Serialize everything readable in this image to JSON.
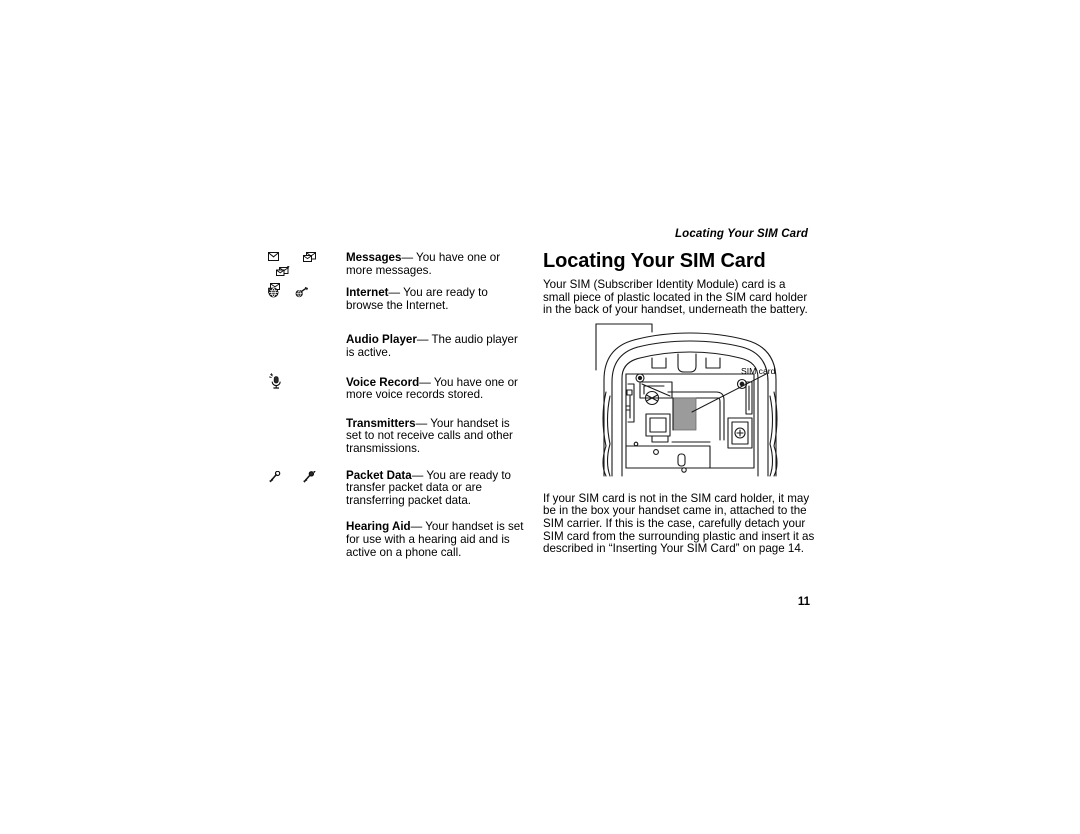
{
  "page": {
    "running_header": "Locating Your SIM Card",
    "folio": "11"
  },
  "left_column": {
    "entries": [
      {
        "term": "Messages",
        "dash": "—",
        "description": " You have one or more messages.",
        "icons": [
          "envelope-icon",
          "message-stack-icon",
          "message-stack-alert-icon",
          "message-open-icon"
        ]
      },
      {
        "term": "Internet",
        "dash": "—",
        "description": " You are ready to browse the Internet.",
        "icons": [
          "globe-icon",
          "globe-key-icon"
        ]
      },
      {
        "term": "Audio Player",
        "dash": "—",
        "description": " The audio player is active.",
        "icons": []
      },
      {
        "term": "Voice Record",
        "dash": "—",
        "description": " You have one or more voice records stored.",
        "icons": [
          "microphone-icon"
        ]
      },
      {
        "term": "Transmitters",
        "dash": "—",
        "description": " Your handset is set to not receive calls and other transmissions.",
        "icons": []
      },
      {
        "term": "Packet Data",
        "dash": "—",
        "description": " You are ready to transfer packet data or are transferring packet data.",
        "icons": [
          "packet-data-icon",
          "packet-data-active-icon"
        ]
      },
      {
        "term": "Hearing Aid",
        "dash": "—",
        "description": " Your handset is set for use with a hearing aid and is active on a phone call.",
        "icons": []
      }
    ]
  },
  "right_column": {
    "title": "Locating Your SIM Card",
    "intro_paragraph": "Your SIM (Subscriber Identity Module) card is a small piece of plastic located in the SIM card holder in the back of your handset, underneath the battery.",
    "figure": {
      "name": "handset-back-sim-card-diagram",
      "callout_label": "SIM card"
    },
    "closing_paragraph": "If your SIM card is not in the SIM card holder, it may be in the box your handset came in, attached to the SIM carrier. If this is the case, carefully detach your SIM card from the surrounding plastic and insert it as described in “Inserting Your SIM Card” on page 14."
  },
  "colors": {
    "text": "#000000",
    "background": "#ffffff",
    "line_art": "#1a1a1a",
    "shade": "#9b9b9b"
  }
}
